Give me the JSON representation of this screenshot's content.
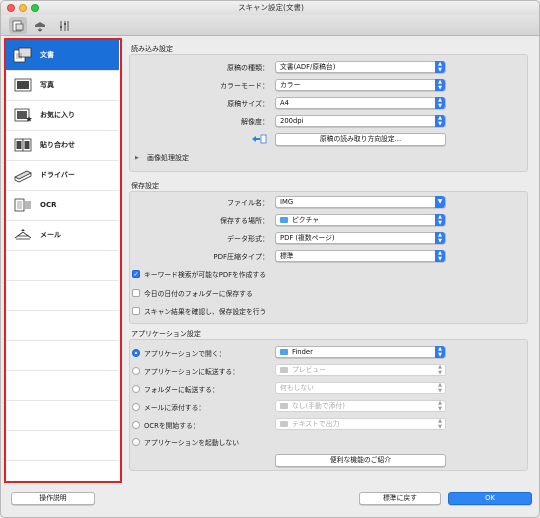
{
  "window": {
    "title": "スキャン設定(文書)"
  },
  "toolbar": {
    "icons": [
      "scan-from-computer-icon",
      "scan-from-panel-icon",
      "general-settings-icon"
    ]
  },
  "sidebar": {
    "items": [
      {
        "label": "文書",
        "icon": "document-scan-icon"
      },
      {
        "label": "写真",
        "icon": "photo-scan-icon"
      },
      {
        "label": "お気に入り",
        "icon": "favorites-icon"
      },
      {
        "label": "貼り合わせ",
        "icon": "stitch-icon"
      },
      {
        "label": "ドライバー",
        "icon": "driver-icon"
      },
      {
        "label": "OCR",
        "icon": "ocr-icon"
      },
      {
        "label": "メール",
        "icon": "mail-icon"
      }
    ]
  },
  "scan_options": {
    "title": "読み込み設定",
    "source_label": "原稿の種類：",
    "source_value": "文書(ADF/原稿台)",
    "color_label": "カラーモード：",
    "color_value": "カラー",
    "size_label": "原稿サイズ：",
    "size_value": "A4",
    "resolution_label": "解像度：",
    "resolution_value": "200dpi",
    "orientation_button": "原稿の読み取り方向設定...",
    "image_processing_label": "画像処理設定"
  },
  "save_settings": {
    "title": "保存設定",
    "filename_label": "ファイル名：",
    "filename_value": "IMG",
    "location_label": "保存する場所：",
    "location_value": "ピクチャ",
    "format_label": "データ形式：",
    "format_value": "PDF (複数ページ)",
    "compression_label": "PDF圧縮タイプ：",
    "compression_value": "標準",
    "checkbox_keyword_pdf": "キーワード検索が可能なPDFを作成する",
    "checkbox_date_folder": "今日の日付のフォルダーに保存する",
    "checkbox_check_results": "スキャン結果を確認し、保存設定を行う"
  },
  "app_settings": {
    "title": "アプリケーション設定",
    "radio_open_app": "アプリケーションで開く：",
    "open_app_value": "Finder",
    "radio_send_app": "アプリケーションに転送する：",
    "send_app_value": "プレビュー",
    "radio_send_folder": "フォルダーに転送する：",
    "send_folder_value": "何もしない",
    "radio_attach_mail": "メールに添付する：",
    "attach_mail_value": "なし(手動で添付)",
    "radio_start_ocr": "OCRを開始する：",
    "start_ocr_value": "テキストで出力",
    "radio_no_app": "アプリケーションを起動しない",
    "more_functions_button": "便利な機能のご紹介"
  },
  "footer": {
    "instructions_button": "操作説明",
    "defaults_button": "標準に戻す",
    "ok_button": "OK"
  },
  "colors": {
    "accent": "#1a6fd8",
    "highlight_border": "#e32020"
  }
}
